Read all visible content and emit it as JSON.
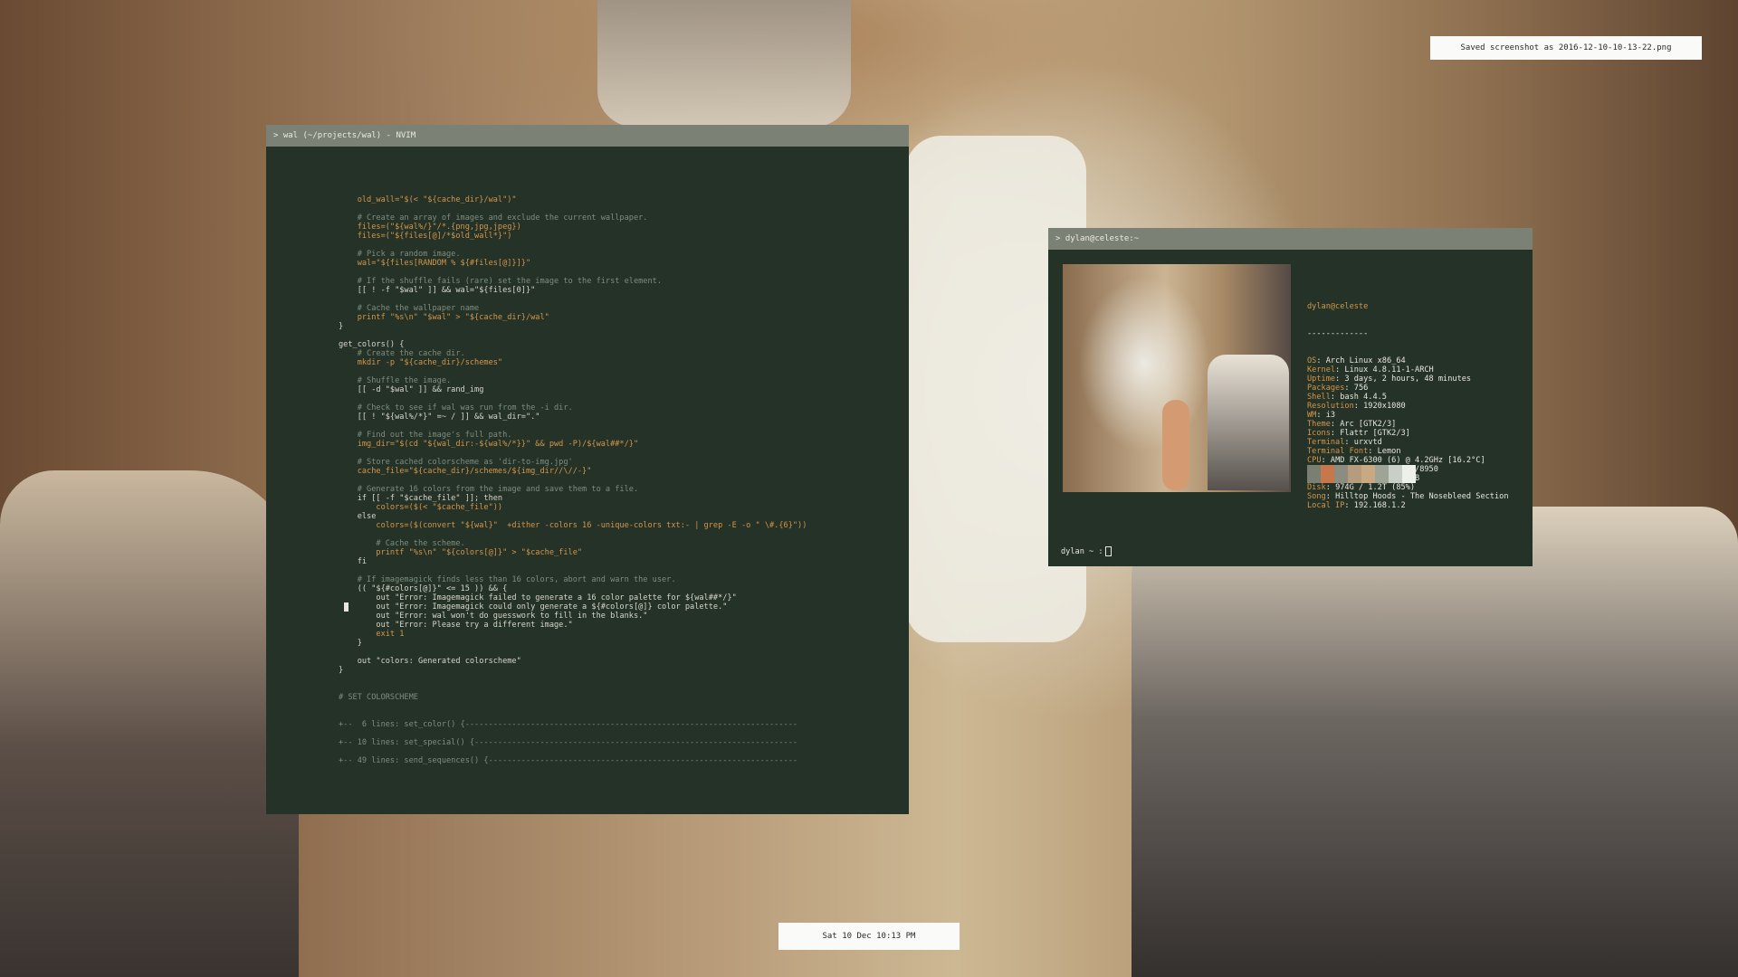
{
  "notification": {
    "text": "Saved screenshot as 2016-12-10-10-13-22.png"
  },
  "clock": {
    "text": "Sat 10 Dec 10:13 PM"
  },
  "nvim": {
    "title": "> wal (~/projects/wal) - NVIM",
    "lines": [
      {
        "t": "    old_wall=\"$(< \"${cache_dir}/wal\")\"",
        "cls": "o"
      },
      {
        "t": "",
        "cls": ""
      },
      {
        "t": "    # Create an array of images and exclude the current wallpaper.",
        "cls": "c"
      },
      {
        "t": "    files=(\"${wal%/}\"/*.{png,jpg,jpeg})",
        "cls": "o"
      },
      {
        "t": "    files=(\"${files[@]/*$old_wall*}\")",
        "cls": "o"
      },
      {
        "t": "",
        "cls": ""
      },
      {
        "t": "    # Pick a random image.",
        "cls": "c"
      },
      {
        "t": "    wal=\"${files[RANDOM % ${#files[@]}]}\"",
        "cls": "o"
      },
      {
        "t": "",
        "cls": ""
      },
      {
        "t": "    # If the shuffle fails (rare) set the image to the first element.",
        "cls": "c"
      },
      {
        "t": "    [[ ! -f \"$wal\" ]] && wal=\"${files[0]}\"",
        "cls": ""
      },
      {
        "t": "",
        "cls": ""
      },
      {
        "t": "    # Cache the wallpaper name",
        "cls": "c"
      },
      {
        "t": "    printf \"%s\\n\" \"$wal\" > \"${cache_dir}/wal\"",
        "cls": "o"
      },
      {
        "t": "}",
        "cls": ""
      },
      {
        "t": "",
        "cls": ""
      },
      {
        "t": "get_colors() {",
        "cls": ""
      },
      {
        "t": "    # Create the cache dir.",
        "cls": "c"
      },
      {
        "t": "    mkdir -p \"${cache_dir}/schemes\"",
        "cls": "o"
      },
      {
        "t": "",
        "cls": ""
      },
      {
        "t": "    # Shuffle the image.",
        "cls": "c"
      },
      {
        "t": "    [[ -d \"$wal\" ]] && rand_img",
        "cls": ""
      },
      {
        "t": "",
        "cls": ""
      },
      {
        "t": "    # Check to see if wal was run from the -i dir.",
        "cls": "c"
      },
      {
        "t": "    [[ ! \"${wal%/*}\" =~ / ]] && wal_dir=\".\"",
        "cls": ""
      },
      {
        "t": "",
        "cls": ""
      },
      {
        "t": "    # Find out the image's full path.",
        "cls": "c"
      },
      {
        "t": "    img_dir=\"$(cd \"${wal_dir:-${wal%/*}}\" && pwd -P)/${wal##*/}\"",
        "cls": "o"
      },
      {
        "t": "",
        "cls": ""
      },
      {
        "t": "    # Store cached colorscheme as 'dir-to-img.jpg'",
        "cls": "c"
      },
      {
        "t": "    cache_file=\"${cache_dir}/schemes/${img_dir//\\//-}\"",
        "cls": "o"
      },
      {
        "t": "",
        "cls": ""
      },
      {
        "t": "    # Generate 16 colors from the image and save them to a file.",
        "cls": "c"
      },
      {
        "t": "    if [[ -f \"$cache_file\" ]]; then",
        "cls": ""
      },
      {
        "t": "        colors=($(< \"$cache_file\"))",
        "cls": "o"
      },
      {
        "t": "    else",
        "cls": ""
      },
      {
        "t": "        colors=($(convert \"${wal}\"  +dither -colors 16 -unique-colors txt:- | grep -E -o \" \\#.{6}\"))",
        "cls": "o"
      },
      {
        "t": "",
        "cls": ""
      },
      {
        "t": "        # Cache the scheme.",
        "cls": "c"
      },
      {
        "t": "        printf \"%s\\n\" \"${colors[@]}\" > \"$cache_file\"",
        "cls": "o"
      },
      {
        "t": "    fi",
        "cls": ""
      },
      {
        "t": "",
        "cls": ""
      },
      {
        "t": "    # If imagemagick finds less than 16 colors, abort and warn the user.",
        "cls": "c"
      },
      {
        "t": "    (( \"${#colors[@]}\" <= 15 )) && {",
        "cls": ""
      },
      {
        "t": "        out \"Error: Imagemagick failed to generate a 16 color palette for ${wal##*/}\"",
        "cls": ""
      },
      {
        "t": "        out \"Error: Imagemagick could only generate a ${#colors[@]} color palette.\"",
        "cls": ""
      },
      {
        "t": "        out \"Error: wal won't do guesswork to fill in the blanks.\"",
        "cls": ""
      },
      {
        "t": "        out \"Error: Please try a different image.\"",
        "cls": ""
      },
      {
        "t": "        exit 1",
        "cls": "o"
      },
      {
        "t": "    }",
        "cls": ""
      },
      {
        "t": "",
        "cls": ""
      },
      {
        "t": "    out \"colors: Generated colorscheme\"",
        "cls": ""
      },
      {
        "t": "}",
        "cls": ""
      },
      {
        "t": "",
        "cls": ""
      },
      {
        "t": "",
        "cls": ""
      },
      {
        "t": "# SET COLORSCHEME",
        "cls": "c"
      },
      {
        "t": "",
        "cls": ""
      },
      {
        "t": "",
        "cls": ""
      },
      {
        "t": "+--  6 lines: set_color() {-----------------------------------------------------------------------",
        "cls": "c"
      },
      {
        "t": "",
        "cls": ""
      },
      {
        "t": "+-- 10 lines: set_special() {---------------------------------------------------------------------",
        "cls": "c"
      },
      {
        "t": "",
        "cls": ""
      },
      {
        "t": "+-- 49 lines: send_sequences() {------------------------------------------------------------------",
        "cls": "c"
      }
    ]
  },
  "terminal": {
    "title": "> dylan@celeste:~",
    "header": "dylan@celeste",
    "separator": "-------------",
    "info": [
      {
        "k": "OS",
        "v": "Arch Linux x86_64"
      },
      {
        "k": "Kernel",
        "v": "Linux 4.8.11-1-ARCH"
      },
      {
        "k": "Uptime",
        "v": "3 days, 2 hours, 48 minutes"
      },
      {
        "k": "Packages",
        "v": "756"
      },
      {
        "k": "Shell",
        "v": "bash 4.4.5"
      },
      {
        "k": "Resolution",
        "v": "1920x1080"
      },
      {
        "k": "WM",
        "v": "i3"
      },
      {
        "k": "Theme",
        "v": "Arc [GTK2/3]"
      },
      {
        "k": "Icons",
        "v": "Flattr [GTK2/3]"
      },
      {
        "k": "Terminal",
        "v": "urxvtd"
      },
      {
        "k": "Terminal Font",
        "v": "Lemon"
      },
      {
        "k": "CPU",
        "v": "AMD FX-6300 (6) @ 4.2GHz [16.2°C]"
      },
      {
        "k": "GPU",
        "v": "AMD Radeon HD 7950/8950"
      },
      {
        "k": "Memory",
        "v": "2656MB / 16009MB"
      },
      {
        "k": "Disk",
        "v": "974G / 1.2T (85%)"
      },
      {
        "k": "Song",
        "v": "Hilltop Hoods - The Nosebleed Section"
      },
      {
        "k": "Local IP",
        "v": "192.168.1.2"
      }
    ],
    "swatches": [
      "#7a7f74",
      "#c7774a",
      "#8c8c80",
      "#b59c7c",
      "#c9a982",
      "#9fa596",
      "#c9cfc6",
      "#eef0ea"
    ],
    "prompt": "dylan ~ :"
  }
}
